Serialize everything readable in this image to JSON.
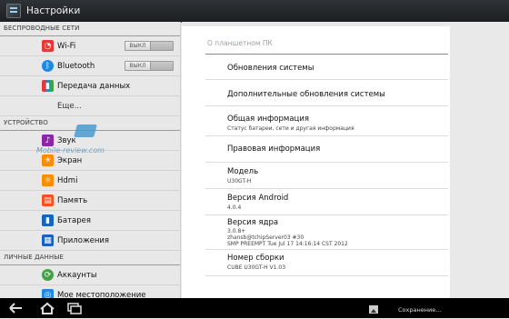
{
  "app": {
    "title": "Настройки"
  },
  "sidebar": {
    "sections": {
      "wireless": "БЕСПРОВОДНЫЕ СЕТИ",
      "device": "УСТРОЙСТВО",
      "personal": "ЛИЧНЫЕ ДАННЫЕ"
    },
    "items": {
      "wifi": {
        "label": "Wi-Fi",
        "toggle": "ВЫКЛ",
        "icon": "wifi-icon",
        "color": "#e53935"
      },
      "bluetooth": {
        "label": "Bluetooth",
        "toggle": "ВЫКЛ",
        "icon": "bluetooth-icon",
        "color": "#1e88e5"
      },
      "data": {
        "label": "Передача данных",
        "icon": "data-usage-icon",
        "color": "#e53935"
      },
      "more": {
        "label": "Еще..."
      },
      "sound": {
        "label": "Звук",
        "icon": "sound-icon",
        "color": "#8e24aa"
      },
      "display": {
        "label": "Экран",
        "icon": "display-icon",
        "color": "#fb8c00"
      },
      "hdmi": {
        "label": "Hdmi",
        "icon": "hdmi-icon",
        "color": "#fb8c00"
      },
      "memory": {
        "label": "Память",
        "icon": "storage-icon",
        "color": "#f4511e"
      },
      "battery": {
        "label": "Батарея",
        "icon": "battery-icon",
        "color": "#1565c0"
      },
      "apps": {
        "label": "Приложения",
        "icon": "apps-icon",
        "color": "#1565c0"
      },
      "accounts": {
        "label": "Аккаунты",
        "icon": "accounts-icon",
        "color": "#43a047"
      },
      "location": {
        "label": "Мое местоположение",
        "icon": "location-icon",
        "color": "#1e88e5"
      }
    },
    "watermark": "Mobile-review.com"
  },
  "panel": {
    "title": "О планшетном ПК",
    "rows": {
      "updates": {
        "title": "Обновления системы"
      },
      "extra_updates": {
        "title": "Дополнительные обновления системы"
      },
      "status": {
        "title": "Общая информация",
        "sub": "Статус батареи, сети и другая информация"
      },
      "legal": {
        "title": "Правовая информация"
      },
      "model": {
        "title": "Модель",
        "value": "U30GT-H"
      },
      "android": {
        "title": "Версия Android",
        "value": "4.0.4"
      },
      "kernel": {
        "title": "Версия ядра",
        "line1": "3.0.8+",
        "line2": "zhansb@tchipServer03 #30",
        "line3": "SMP PREEMPT Tue Jul 17 14:16:14 CST 2012"
      },
      "build": {
        "title": "Номер сборки",
        "value": "CUBE U30GT-H V1.03"
      }
    }
  },
  "navbar": {
    "notification": "Сохранение..."
  }
}
